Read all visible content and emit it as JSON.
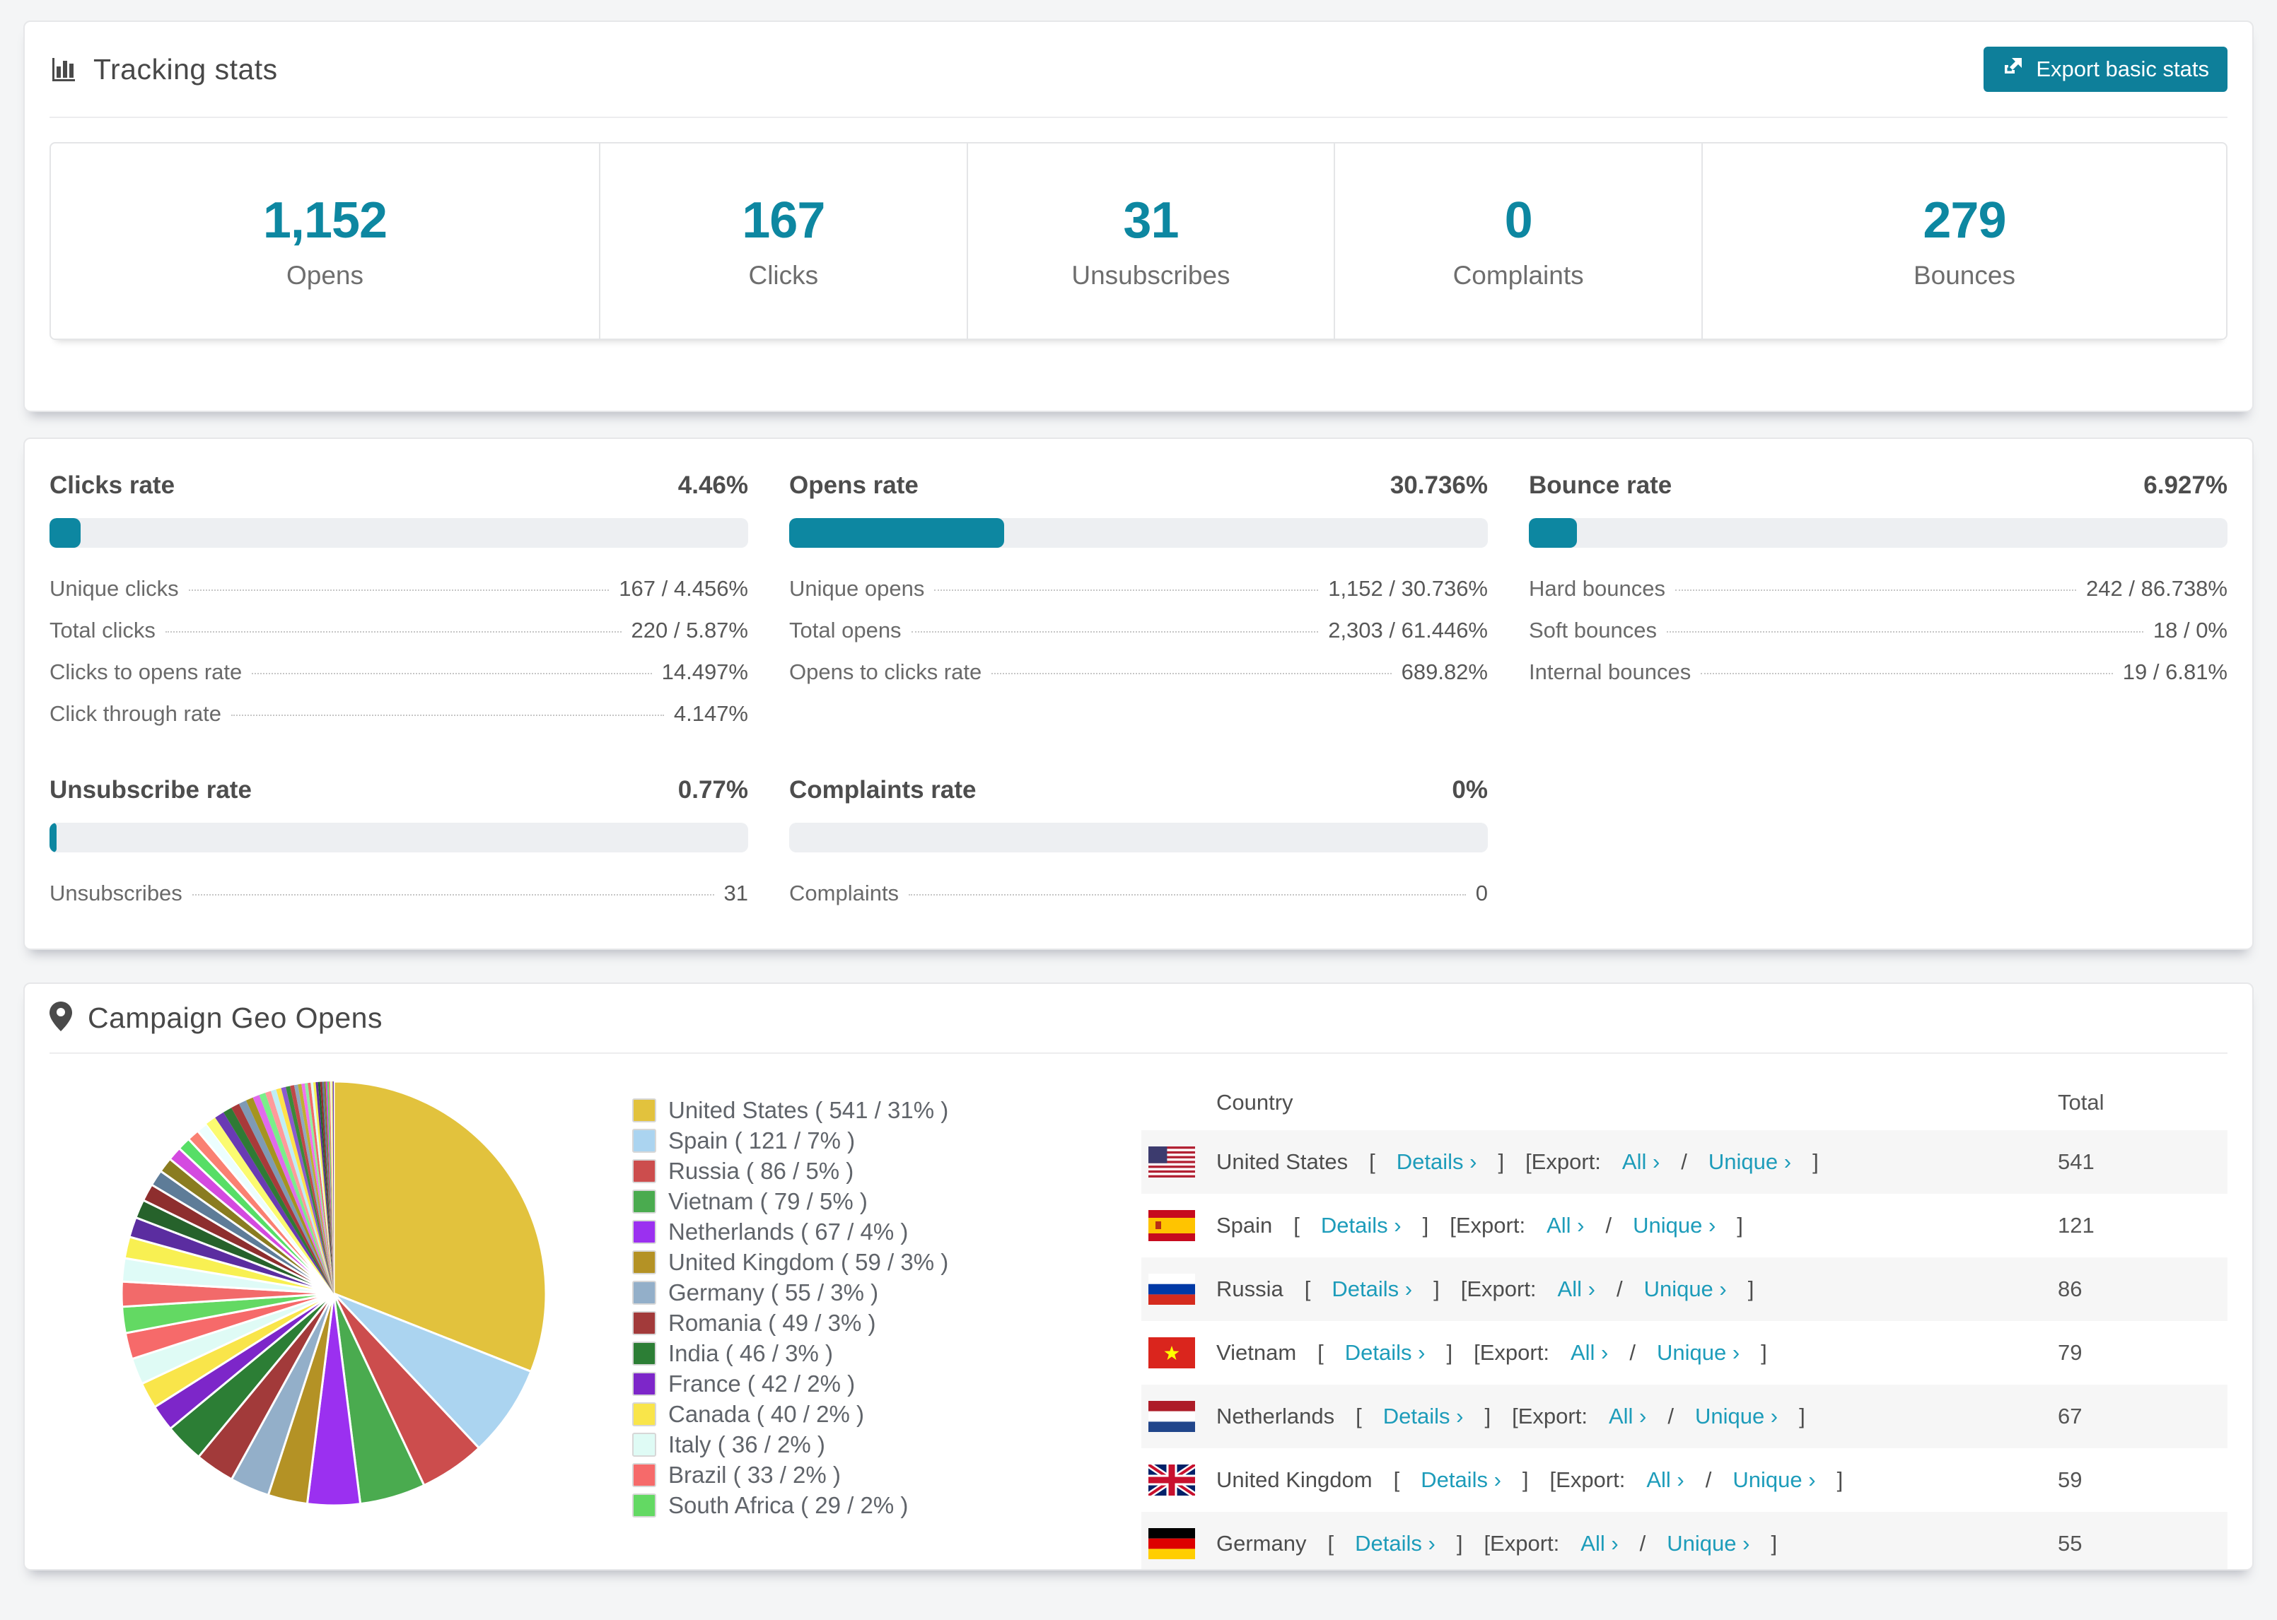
{
  "colors": {
    "accent_teal": "#0d87a1",
    "button_teal": "#0e7f9a",
    "link_teal": "#1d9cba",
    "bar_track": "#edeff2",
    "card_border": "#e6e7e9",
    "row_alt_bg": "#f6f6f6"
  },
  "tracking": {
    "title": "Tracking stats",
    "export_button": "Export basic stats",
    "stats": [
      {
        "value": "1,152",
        "label": "Opens"
      },
      {
        "value": "167",
        "label": "Clicks"
      },
      {
        "value": "31",
        "label": "Unsubscribes"
      },
      {
        "value": "0",
        "label": "Complaints"
      },
      {
        "value": "279",
        "label": "Bounces"
      }
    ]
  },
  "rates": {
    "blocks": [
      {
        "title": "Clicks rate",
        "value": "4.46%",
        "percent": 4.46,
        "rows": [
          {
            "label": "Unique clicks",
            "value": "167 / 4.456%"
          },
          {
            "label": "Total clicks",
            "value": "220 / 5.87%"
          },
          {
            "label": "Clicks to opens rate",
            "value": "14.497%"
          },
          {
            "label": "Click through rate",
            "value": "4.147%"
          }
        ]
      },
      {
        "title": "Opens rate",
        "value": "30.736%",
        "percent": 30.736,
        "rows": [
          {
            "label": "Unique opens",
            "value": "1,152 / 30.736%"
          },
          {
            "label": "Total opens",
            "value": "2,303 / 61.446%"
          },
          {
            "label": "Opens to clicks rate",
            "value": "689.82%"
          }
        ]
      },
      {
        "title": "Bounce rate",
        "value": "6.927%",
        "percent": 6.927,
        "rows": [
          {
            "label": "Hard bounces",
            "value": "242 / 86.738%"
          },
          {
            "label": "Soft bounces",
            "value": "18 / 0%"
          },
          {
            "label": "Internal bounces",
            "value": "19 / 6.81%"
          }
        ]
      },
      {
        "title": "Unsubscribe rate",
        "value": "0.77%",
        "percent": 0.77,
        "rows": [
          {
            "label": "Unsubscribes",
            "value": "31"
          }
        ]
      },
      {
        "title": "Complaints rate",
        "value": "0%",
        "percent": 0,
        "rows": [
          {
            "label": "Complaints",
            "value": "0"
          }
        ]
      }
    ]
  },
  "geo": {
    "title": "Campaign Geo Opens",
    "chart_data": {
      "type": "pie",
      "title": "Campaign Geo Opens",
      "legend_position": "right",
      "slices": [
        {
          "label": "United States",
          "value": 541,
          "percent": 31,
          "color": "#e2c23d",
          "legend_text": "United States ( 541 / 31% )"
        },
        {
          "label": "Spain",
          "value": 121,
          "percent": 7,
          "color": "#abd4f0",
          "legend_text": "Spain ( 121 / 7% )"
        },
        {
          "label": "Russia",
          "value": 86,
          "percent": 5,
          "color": "#cc4d4d",
          "legend_text": "Russia ( 86 / 5% )"
        },
        {
          "label": "Vietnam",
          "value": 79,
          "percent": 5,
          "color": "#4aab4f",
          "legend_text": "Vietnam ( 79 / 5% )"
        },
        {
          "label": "Netherlands",
          "value": 67,
          "percent": 4,
          "color": "#9b30f0",
          "legend_text": "Netherlands ( 67 / 4% )"
        },
        {
          "label": "United Kingdom",
          "value": 59,
          "percent": 3,
          "color": "#b49225",
          "legend_text": "United Kingdom ( 59 / 3% )"
        },
        {
          "label": "Germany",
          "value": 55,
          "percent": 3,
          "color": "#93afc9",
          "legend_text": "Germany ( 55 / 3% )"
        },
        {
          "label": "Romania",
          "value": 49,
          "percent": 3,
          "color": "#a23a3a",
          "legend_text": "Romania ( 49 / 3% )"
        },
        {
          "label": "India",
          "value": 46,
          "percent": 3,
          "color": "#2c7e35",
          "legend_text": "India ( 46 / 3% )"
        },
        {
          "label": "France",
          "value": 42,
          "percent": 2,
          "color": "#7d26c9",
          "legend_text": "France ( 42 / 2% )"
        },
        {
          "label": "Canada",
          "value": 40,
          "percent": 2,
          "color": "#f9e54a",
          "legend_text": "Canada ( 40 / 2% )"
        },
        {
          "label": "Italy",
          "value": 36,
          "percent": 2,
          "color": "#dffbf5",
          "legend_text": "Italy ( 36 / 2% )"
        },
        {
          "label": "Brazil",
          "value": 33,
          "percent": 2,
          "color": "#f66a6a",
          "legend_text": "Brazil ( 33 / 2% )"
        },
        {
          "label": "South Africa",
          "value": 29,
          "percent": 2,
          "color": "#63d963",
          "legend_text": "South Africa ( 29 / 2% )"
        }
      ],
      "other_slices": {
        "percent_total": 26,
        "slice_count": 44,
        "note": "many unlabeled thin slices fanning toward 12 o'clock"
      }
    },
    "table": {
      "headers": {
        "country": "Country",
        "total": "Total"
      },
      "links": {
        "details": "Details ›",
        "export_prefix": "[Export:",
        "all": "All ›",
        "slash": "/",
        "unique": "Unique ›"
      },
      "rows": [
        {
          "country": "United States",
          "flag": "us",
          "total": "541"
        },
        {
          "country": "Spain",
          "flag": "es",
          "total": "121"
        },
        {
          "country": "Russia",
          "flag": "ru",
          "total": "86"
        },
        {
          "country": "Vietnam",
          "flag": "vn",
          "total": "79"
        },
        {
          "country": "Netherlands",
          "flag": "nl",
          "total": "67"
        },
        {
          "country": "United Kingdom",
          "flag": "gb",
          "total": "59"
        },
        {
          "country": "Germany",
          "flag": "de",
          "total": "55"
        }
      ]
    }
  }
}
